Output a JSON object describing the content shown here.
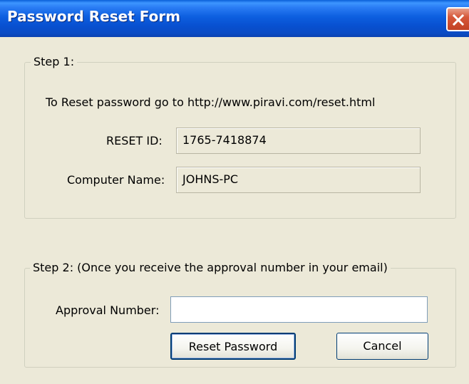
{
  "window": {
    "title": "Password Reset Form",
    "close_icon": "close-icon",
    "colors": {
      "titlebar": "#0a5fd8",
      "close_button": "#d6583a",
      "background": "#ece9d8"
    }
  },
  "step1": {
    "title": "Step 1:",
    "instruction": "To Reset password go to http://www.piravi.com/reset.html",
    "reset_id": {
      "label": "RESET ID:",
      "value": "1765-7418874"
    },
    "computer_name": {
      "label": "Computer Name:",
      "value": "JOHNS-PC"
    }
  },
  "step2": {
    "title": "Step 2:  (Once you receive the approval number in your email)",
    "approval_number": {
      "label": "Approval Number:",
      "value": ""
    },
    "buttons": {
      "reset_label": "Reset Password",
      "cancel_label": "Cancel"
    }
  }
}
